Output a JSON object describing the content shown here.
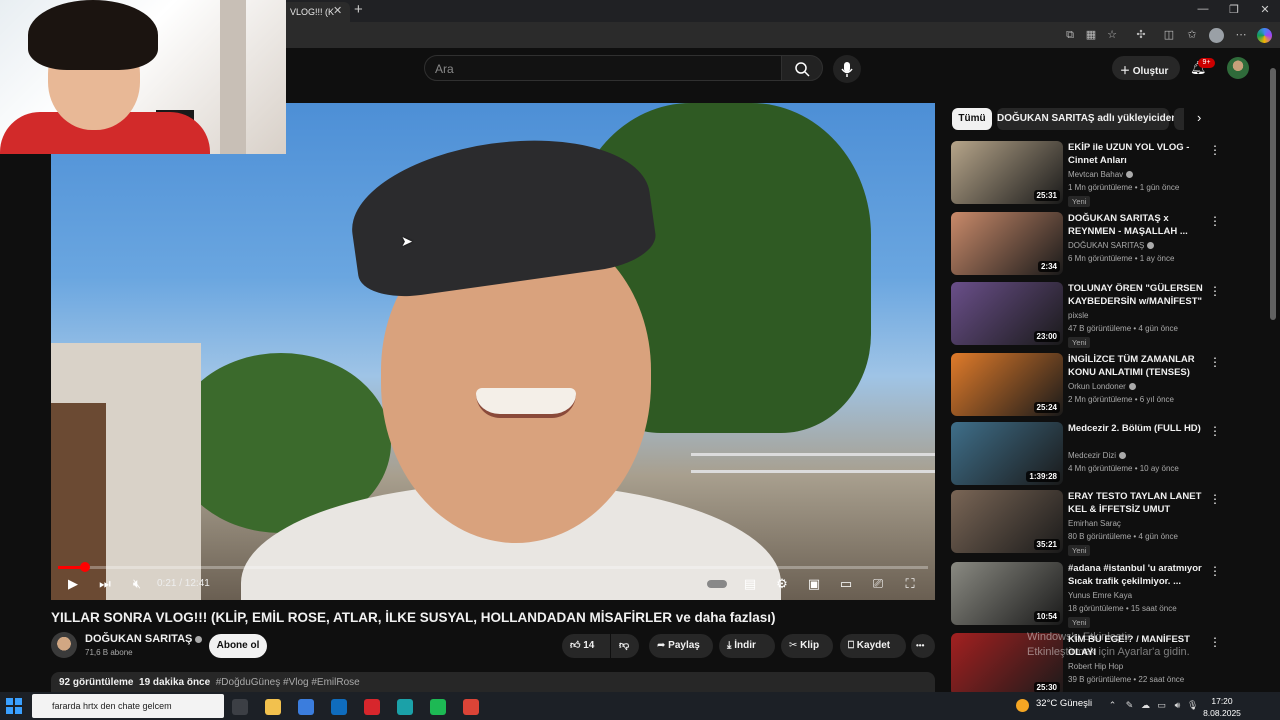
{
  "browser": {
    "tab_title": "VLOG!!! (K",
    "tab_close_glyph": "✕",
    "new_tab_glyph": "+",
    "window_controls": [
      "—",
      "❐",
      "✕"
    ],
    "toolbar_icons": [
      "screen-share-icon",
      "apps-icon",
      "favorite-star-icon",
      "extensions-icon",
      "split-screen-icon",
      "favorites-icon",
      "profile-icon",
      "more-icon",
      "copilot-icon"
    ]
  },
  "header": {
    "search_placeholder": "Ara",
    "create_label": "Oluştur",
    "notifications_badge": "9+"
  },
  "player": {
    "current_time": "0:21",
    "duration": "12:41",
    "time_text": "0:21 / 12:41",
    "progress_fraction": 0.028,
    "buttons": [
      "play-button",
      "next-button",
      "mute-button",
      "autoplay-toggle",
      "subtitles-button",
      "settings-button",
      "miniplayer-button",
      "theater-button",
      "cast-button",
      "fullscreen-button"
    ]
  },
  "video": {
    "title": "YILLAR SONRA VLOG!!! (KLİP, EMİL ROSE, ATLAR, İLKE SUSYAL, HOLLANDADAN MİSAFİRLER ve daha fazlası)",
    "channel_name": "DOĞUKAN SARITAŞ",
    "subscribers": "71,6 B abone",
    "subscribe_label": "Abone ol",
    "likes": "14",
    "share_label": "Paylaş",
    "download_label": "İndir",
    "clip_label": "Klip",
    "save_label": "Kaydet",
    "more_label": "•••",
    "views": "92 görüntüleme",
    "uploaded": "19 dakika önce",
    "tags": "#DoğduGüneş #Vlog #EmilRose"
  },
  "sidebar": {
    "chips": [
      "Tümü",
      "DOĞUKAN SARITAŞ adlı yükleyiciden"
    ],
    "recommendations": [
      {
        "title": "EKİP ile UZUN YOL VLOG - Cinnet Anları",
        "channel": "Mevtcan Bahav",
        "verified": true,
        "meta": "1 Mn görüntüleme • 1 gün önce",
        "badge": "Yeni",
        "duration": "25:31",
        "thumb": "#b6a58a"
      },
      {
        "title": "DOĞUKAN SARITAŞ x REYNMEN - MAŞALLAH ...",
        "channel": "DOĞUKAN SARITAŞ",
        "verified": true,
        "meta": "6 Mn görüntüleme • 1 ay önce",
        "badge": "",
        "duration": "2:34",
        "thumb": "#c98a6a"
      },
      {
        "title": "TOLUNAY ÖREN \"GÜLERSEN KAYBEDERSİN w/MANİFEST\" ...",
        "channel": "pixsle",
        "verified": false,
        "meta": "47 B görüntüleme • 4 gün önce",
        "badge": "Yeni",
        "duration": "23:00",
        "thumb": "#6a4f8a"
      },
      {
        "title": "İNGİLİZCE TÜM ZAMANLAR KONU ANLATIMI (TENSES)",
        "channel": "Orkun Londoner",
        "verified": true,
        "meta": "2 Mn görüntüleme • 6 yıl önce",
        "badge": "",
        "duration": "25:24",
        "thumb": "#e07b2a"
      },
      {
        "title": "Medcezir 2. Bölüm (FULL HD)",
        "channel": "Medcezir Dizi",
        "verified": true,
        "meta": "4 Mn görüntüleme • 10 ay önce",
        "badge": "",
        "duration": "1:39:28",
        "thumb": "#3f6f8a"
      },
      {
        "title": "ERAY TESTO TAYLAN LANET KEL & İFFETSİZ UMUT İZLİYOR",
        "channel": "Emirhan Saraç",
        "verified": false,
        "meta": "80 B görüntüleme • 4 gün önce",
        "badge": "Yeni",
        "duration": "35:21",
        "thumb": "#7a6656"
      },
      {
        "title": "#adana #istanbul 'u aratmıyor Sıcak trafik çekilmiyor. ...",
        "channel": "Yunus Emre Kaya",
        "verified": false,
        "meta": "18 görüntüleme • 15 saat önce",
        "badge": "Yeni",
        "duration": "10:54",
        "thumb": "#8a8a82"
      },
      {
        "title": "KİM BU EGE!? / MANİFEST OLAYI",
        "channel": "Robert Hip Hop",
        "verified": false,
        "meta": "39 B görüntüleme • 22 saat önce",
        "badge": "",
        "duration": "25:30",
        "thumb": "#a32020"
      }
    ]
  },
  "watermark": {
    "line1": "Windows'u Etkinleştir",
    "line2": "Etkinleştirmek için Ayarlar'a gidin."
  },
  "taskbar": {
    "search_text": "fararda hrtx den chate gelcem",
    "weather": "32°C  Güneşli",
    "time": "17:20",
    "date": "8.08.2025",
    "apps": [
      {
        "name": "task-view-icon",
        "color": "#3c3f45"
      },
      {
        "name": "file-explorer-icon",
        "color": "#f2c14e"
      },
      {
        "name": "microsoft-store-icon",
        "color": "#3b7ddd"
      },
      {
        "name": "outlook-icon",
        "color": "#0f6cbd"
      },
      {
        "name": "opera-icon",
        "color": "#d7262c"
      },
      {
        "name": "edge-icon",
        "color": "#1ba1a8"
      },
      {
        "name": "spotify-icon",
        "color": "#1db954"
      },
      {
        "name": "chrome-icon",
        "color": "#db4437"
      }
    ]
  },
  "colors": {
    "accent": "#ff0000",
    "background": "#0f0f0f",
    "pill": "#272727"
  }
}
